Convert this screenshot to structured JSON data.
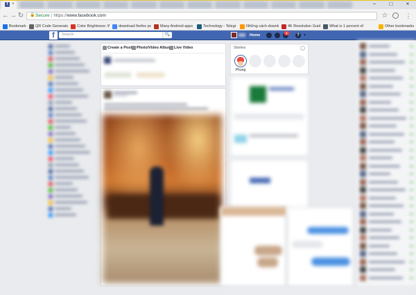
{
  "browser": {
    "tab_favicon_letter": "f",
    "tab_close": "×",
    "window_controls": {
      "minimize": "–",
      "maximize": "□",
      "close": "×"
    },
    "nav": {
      "back": "←",
      "forward": "→",
      "reload": "↻"
    },
    "omnibox": {
      "secure_label": "Secure",
      "protocol": "https://",
      "host": "www.facebook.com"
    },
    "star": "☆",
    "menu": "⋮",
    "bookmarks": [
      {
        "label": "Bookmarks",
        "icon": "bookmarks-star-icon",
        "color": "#1a73e8"
      },
      {
        "label": "QR Code Generator",
        "icon": "qr-code-icon",
        "color": "#5f6368"
      },
      {
        "label": "Color Brightness: Wi",
        "icon": "red-square-icon",
        "color": "#d93025"
      },
      {
        "label": "download firefox pc -",
        "icon": "arrow-down-icon",
        "color": "#4285f4"
      },
      {
        "label": "Many Android apps",
        "icon": "red-square-icon",
        "color": "#b23121"
      },
      {
        "label": "Technology - Telegr",
        "icon": "diamond-icon",
        "color": "#1b5e7a"
      },
      {
        "label": "Những cách downlo",
        "icon": "orange-square-icon",
        "color": "#ff9800"
      },
      {
        "label": "4K Resolution Guide",
        "icon": "red-k-icon",
        "color": "#c62828"
      },
      {
        "label": "What is 1 percent of",
        "icon": "calculator-icon",
        "color": "#455a64"
      },
      {
        "label": "Other bookmarks",
        "icon": "folder-icon",
        "color": "#f4b400"
      }
    ]
  },
  "facebook": {
    "logo": "f",
    "search": {
      "placeholder": "Search",
      "button_icon": "🔍"
    },
    "home_label": "Home",
    "notification_count": "1",
    "help": "?",
    "caret": "▼",
    "composer": {
      "tabs": [
        {
          "label": "Create a Post",
          "icon": "pencil-icon",
          "color": "#7f7f7f"
        },
        {
          "label": "Photo/Video Album",
          "icon": "album-icon",
          "color": "#7f7f7f"
        },
        {
          "label": "Live Video",
          "icon": "video-camera-icon",
          "color": "#7f7f7f"
        }
      ]
    },
    "stories": {
      "title": "Stories",
      "options_icon": "...",
      "items": [
        {
          "name": "Phung"
        }
      ]
    }
  },
  "colors": {
    "fb_blue": "#4267b2",
    "fb_bg": "#e9ebee",
    "online_green": "#42b72a",
    "notification_red": "#fa3e3e"
  }
}
